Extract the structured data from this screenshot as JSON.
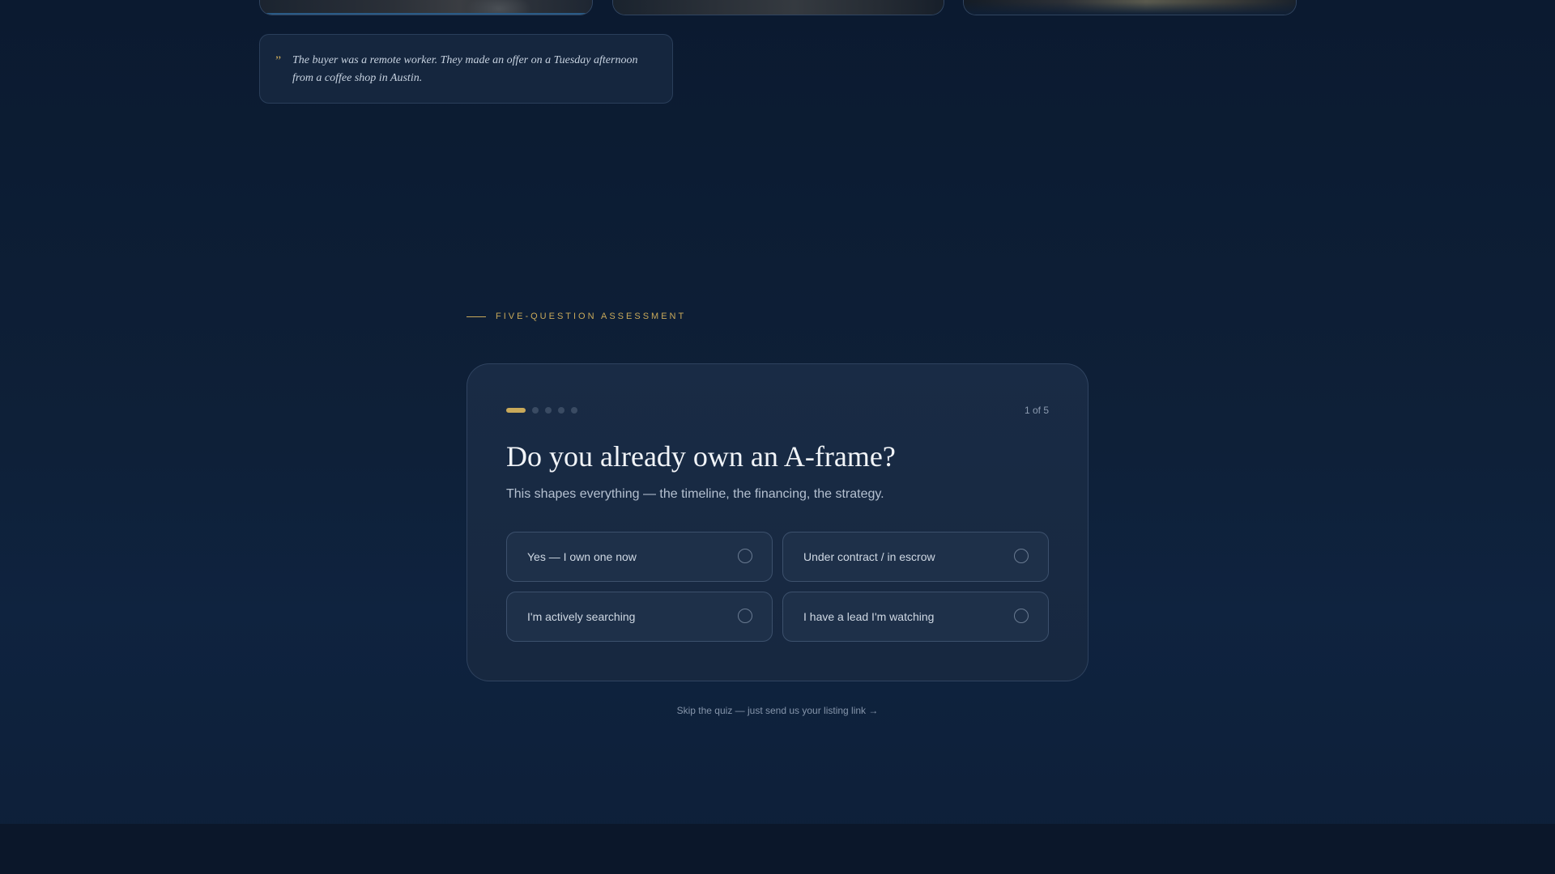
{
  "quote": {
    "mark": "”",
    "text": "The buyer was a remote worker. They made an offer on a Tuesday afternoon from a coffee shop in Austin."
  },
  "assessment": {
    "eyebrow": "FIVE-QUESTION ASSESSMENT",
    "step_counter": "1 of 5",
    "progress": {
      "current_step": 1,
      "total_steps": 5
    },
    "question": "Do you already own an A-frame?",
    "subtitle": "This shapes everything — the timeline, the financing, the strategy.",
    "options": [
      {
        "label": "Yes — I own one now",
        "selected": false
      },
      {
        "label": "Under contract / in escrow",
        "selected": false
      },
      {
        "label": "I'm actively searching",
        "selected": false
      },
      {
        "label": "I have a lead I'm watching",
        "selected": false
      }
    ],
    "skip_link": "Skip the quiz — just send us your listing link →"
  },
  "colors": {
    "accent_gold": "#c9a95a",
    "background": "#0e2038",
    "card": "#192b45"
  }
}
